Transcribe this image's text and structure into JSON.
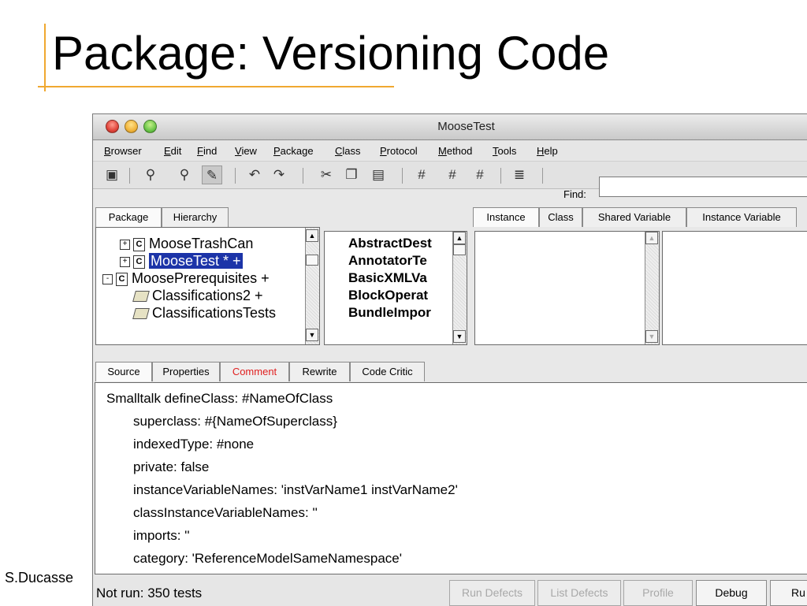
{
  "slide": {
    "title": "Package: Versioning Code",
    "author": "S.Ducasse"
  },
  "window": {
    "title": "MooseTest"
  },
  "menu": [
    "Browser",
    "Edit",
    "Find",
    "View",
    "Package",
    "Class",
    "Protocol",
    "Method",
    "Tools",
    "Help"
  ],
  "toolbar": {
    "find_label": "Find:",
    "find_value": ""
  },
  "left_tabs": [
    "Package",
    "Hierarchy"
  ],
  "right_tabs": [
    "Instance",
    "Class",
    "Shared Variable",
    "Instance Variable"
  ],
  "package_tree": [
    {
      "label": "MooseTrashCan",
      "expander": "+",
      "kind": "class"
    },
    {
      "label": "MooseTest * +",
      "expander": "+",
      "kind": "class",
      "selected": true
    },
    {
      "label": "MoosePrerequisites +",
      "expander": "-",
      "kind": "class"
    },
    {
      "label": "Classifications2 +",
      "expander": "",
      "kind": "package"
    },
    {
      "label": "ClassificationsTests",
      "expander": "",
      "kind": "package"
    }
  ],
  "class_list": [
    "AbstractDest",
    "AnnotatorTe",
    "BasicXMLVa",
    "BlockOperat",
    "BundleImpor"
  ],
  "source_tabs": [
    "Source",
    "Properties",
    "Comment",
    "Rewrite",
    "Code Critic"
  ],
  "source_code": [
    "Smalltalk defineClass: #NameOfClass",
    "superclass: #{NameOfSuperclass}",
    "indexedType: #none",
    "private: false",
    "instanceVariableNames: 'instVarName1 instVarName2'",
    "classInstanceVariableNames: ''",
    "imports: ''",
    "category: 'ReferenceModelSameNamespace'"
  ],
  "status": {
    "text": "Not run: 350 tests",
    "buttons": [
      "Run Defects",
      "List Defects",
      "Profile",
      "Debug",
      "Ru"
    ]
  },
  "colors": {
    "accent": "#f0a830",
    "selection": "#1c34a8",
    "comment_tab": "#e02020"
  }
}
